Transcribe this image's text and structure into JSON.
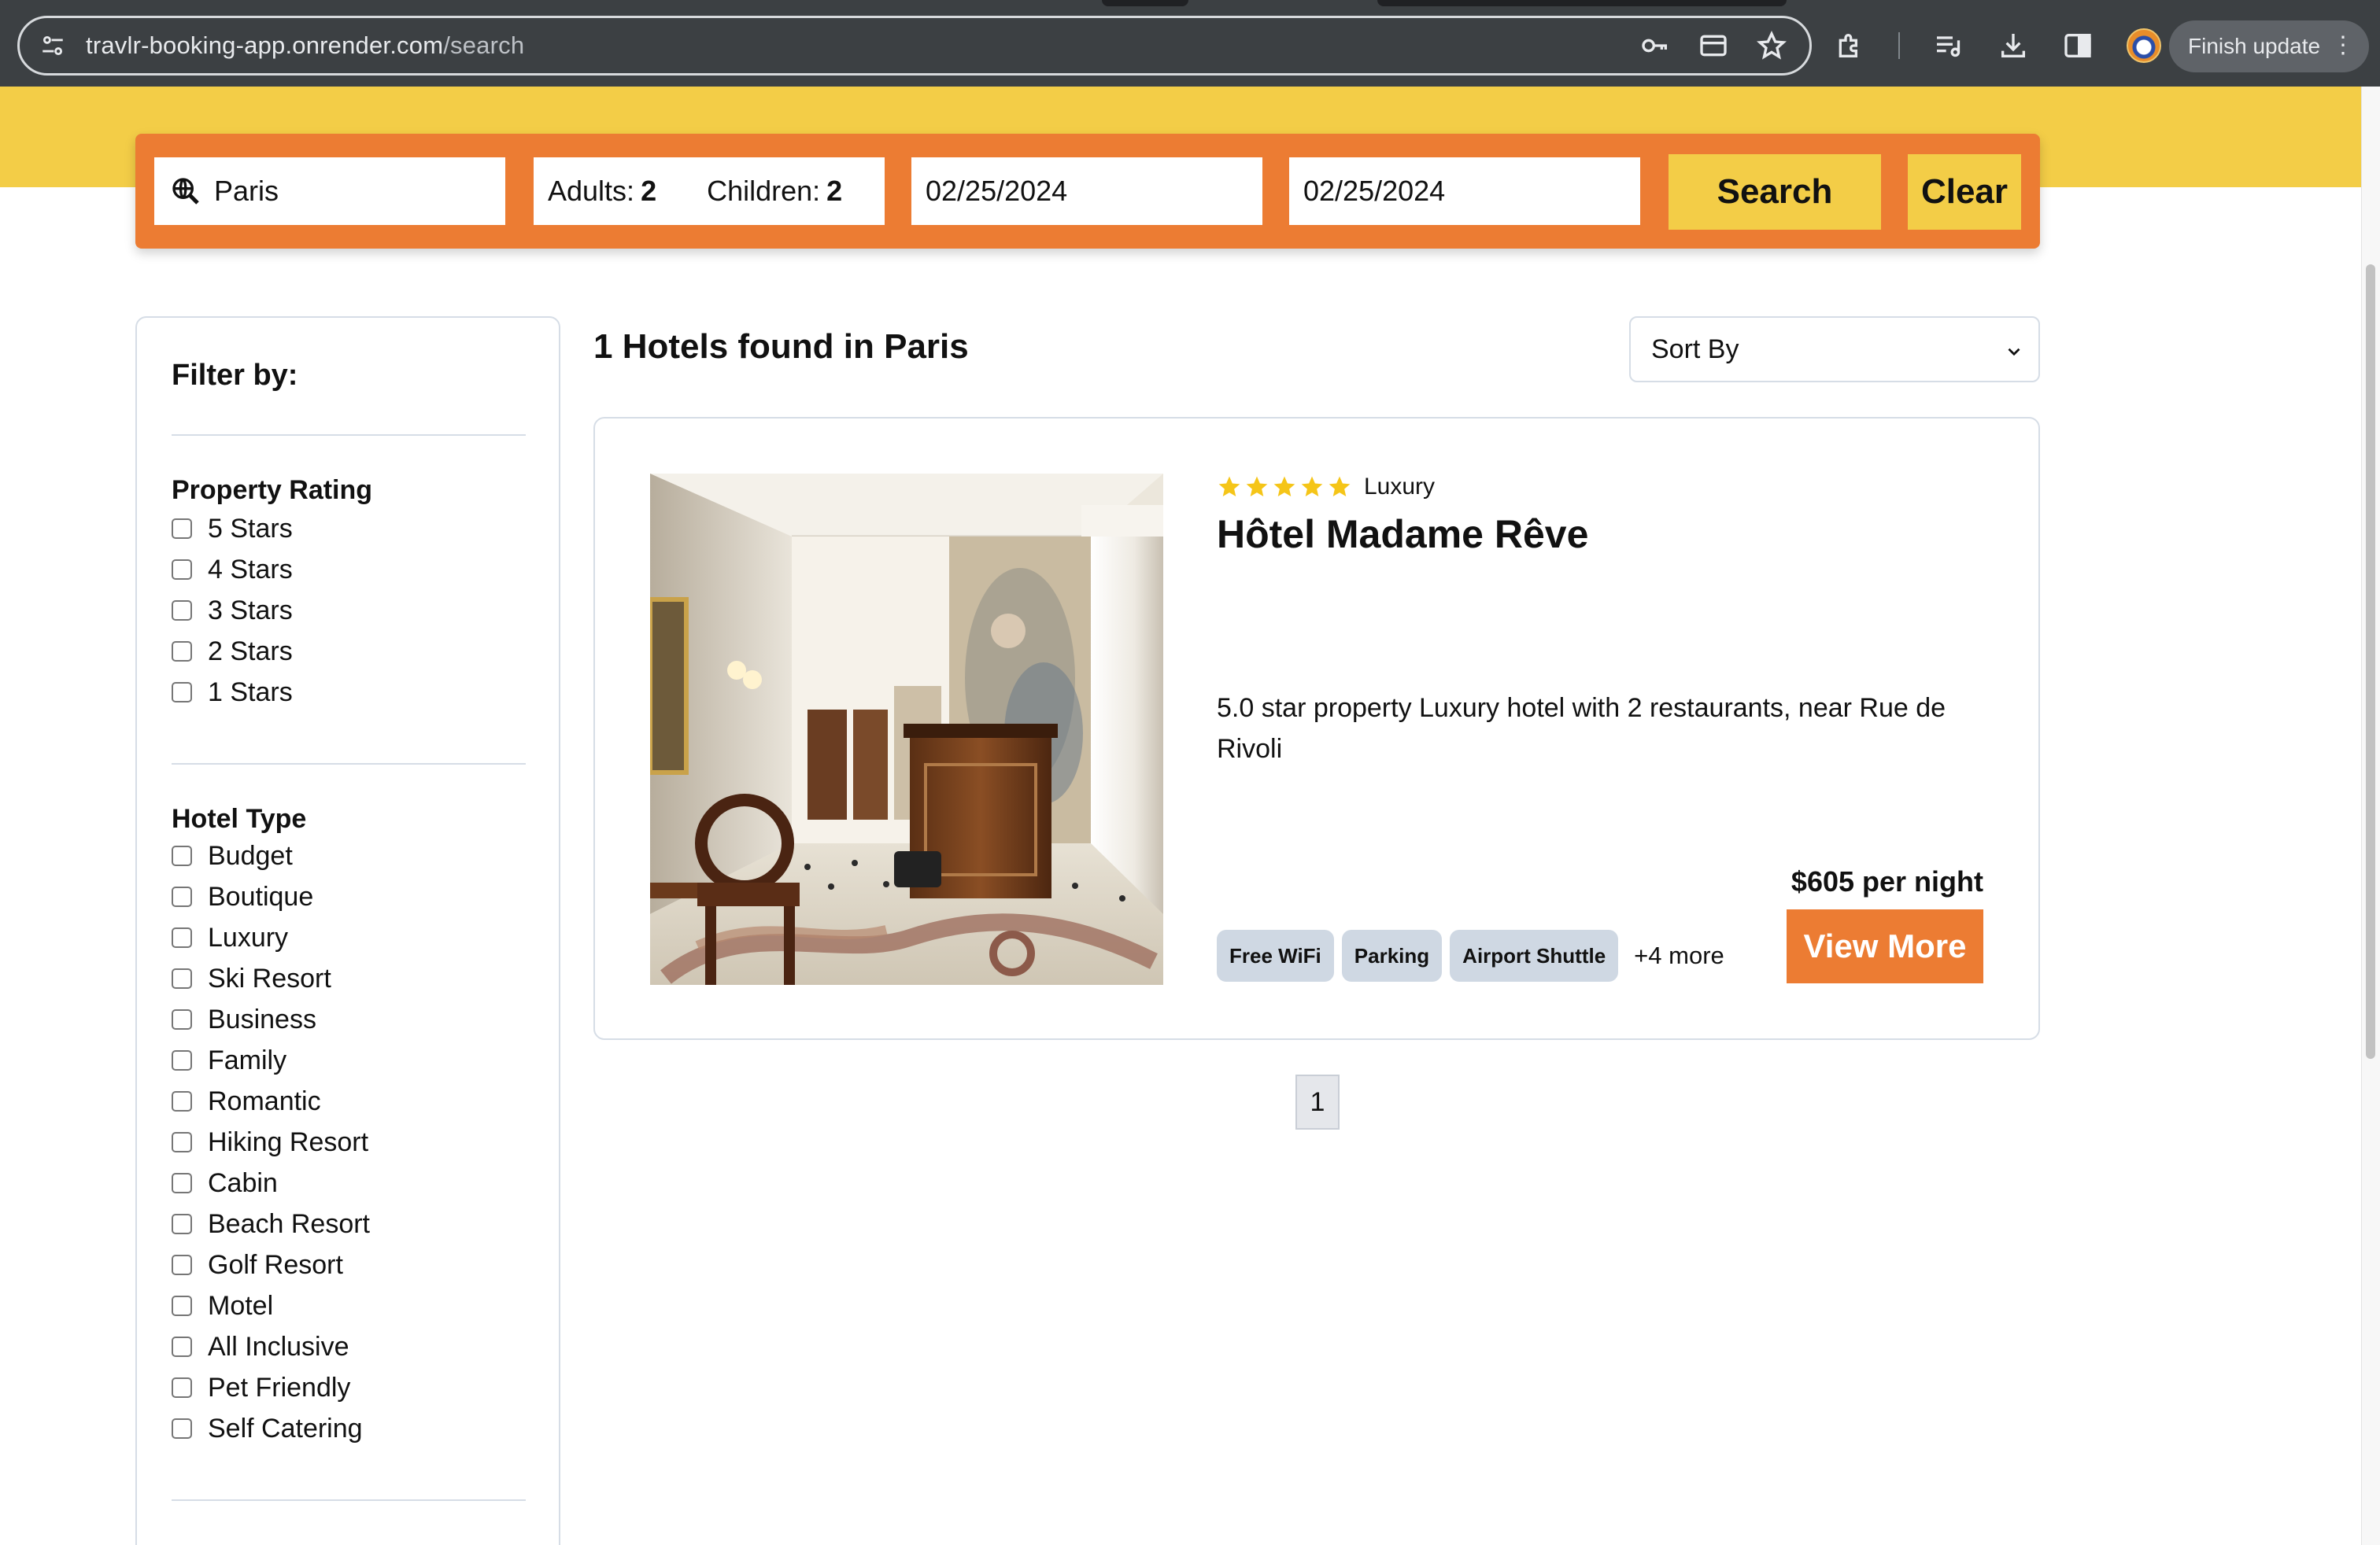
{
  "browser": {
    "url_host": "travlr-booking-app.onrender.com",
    "url_path": "/search",
    "finish_update_label": "Finish update",
    "menu_glyph": "⋮"
  },
  "search": {
    "destination": "Paris",
    "adults_label": "Adults:",
    "adults_value": "2",
    "children_label": "Children:",
    "children_value": "2",
    "check_in": "02/25/2024",
    "check_out": "02/25/2024",
    "search_button": "Search",
    "clear_button": "Clear"
  },
  "filters": {
    "heading": "Filter by:",
    "rating_title": "Property Rating",
    "rating_options": [
      "5 Stars",
      "4 Stars",
      "3 Stars",
      "2 Stars",
      "1 Stars"
    ],
    "type_title": "Hotel Type",
    "type_options": [
      "Budget",
      "Boutique",
      "Luxury",
      "Ski Resort",
      "Business",
      "Family",
      "Romantic",
      "Hiking Resort",
      "Cabin",
      "Beach Resort",
      "Golf Resort",
      "Motel",
      "All Inclusive",
      "Pet Friendly",
      "Self Catering"
    ]
  },
  "results": {
    "title": "1 Hotels found in Paris",
    "sort_label": "Sort By",
    "hotel": {
      "star_count": 5,
      "type": "Luxury",
      "name": "Hôtel Madame Rêve",
      "description": "5.0 star property Luxury hotel with 2 restaurants, near Rue de Rivoli",
      "amenities": [
        "Free WiFi",
        "Parking",
        "Airport Shuttle"
      ],
      "more_label": "+4 more",
      "price": "$605 per night",
      "view_more": "View More"
    },
    "page": "1"
  },
  "colors": {
    "banner_yellow": "#f3cd47",
    "search_orange": "#ec7c33",
    "star_gold": "#f5c518",
    "chip_gray": "#cfd8e3"
  },
  "icons": {
    "site_info": "tune-icon",
    "password": "key-icon",
    "card": "credit-card-icon",
    "bookmark": "star-outline-icon",
    "extensions": "puzzle-icon",
    "media": "playlist-icon",
    "download": "download-icon",
    "sidepanel": "side-panel-icon",
    "destination": "globe-search-icon"
  }
}
